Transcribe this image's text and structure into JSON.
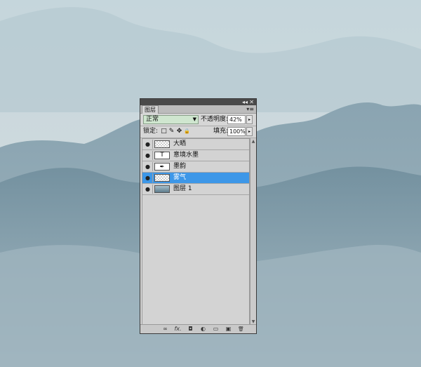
{
  "panel": {
    "tab_label": "图层",
    "collapse_glyph": "◂◂",
    "close_glyph": "✕",
    "menu_glyph": "▾≡"
  },
  "blend_mode": {
    "value": "正常",
    "arrow": "▼"
  },
  "opacity": {
    "label": "不透明度:",
    "value": "42%",
    "step": "▸"
  },
  "lock": {
    "label": "锁定:",
    "icons": [
      "□",
      "✎",
      "✥",
      "🔒"
    ]
  },
  "fill": {
    "label": "填充:",
    "value": "100%",
    "step": "▸"
  },
  "layers": [
    {
      "name": "大晒",
      "thumb": "checker",
      "selected": false
    },
    {
      "name": "意境水墨",
      "thumb": "text",
      "thumb_glyph": "T",
      "selected": false
    },
    {
      "name": "墨韵",
      "thumb": "glyph",
      "thumb_glyph": "✒",
      "selected": false
    },
    {
      "name": "雾气",
      "thumb": "checker",
      "selected": true
    },
    {
      "name": "图层 1",
      "thumb": "img",
      "selected": false
    }
  ],
  "footer_icons": [
    "link-icon",
    "fx-icon",
    "mask-icon",
    "adjustment-icon",
    "group-icon",
    "new-layer-icon",
    "delete-icon"
  ],
  "footer_glyphs": [
    "∞",
    "fx.",
    "◘",
    "◐",
    "▭",
    "▣",
    "🗑"
  ],
  "colors": {
    "selection": "#3d97e8",
    "blend_bg": "#cfe6cf",
    "panel_bg": "#d6d6d6"
  }
}
